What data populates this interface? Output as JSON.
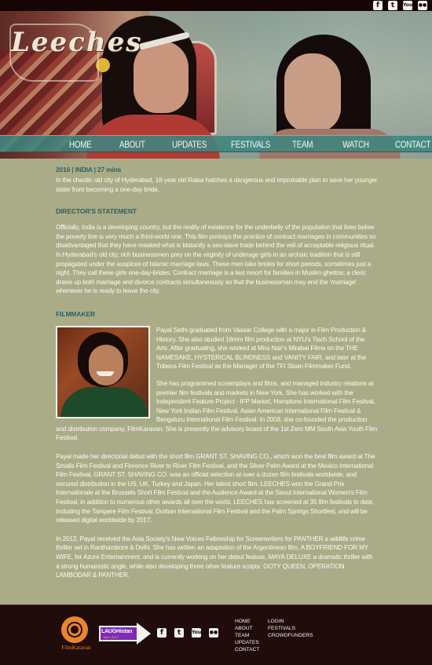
{
  "social": {
    "facebook_glyph": "f",
    "twitter_glyph": "t",
    "youtube_glyph": "You",
    "flickr_glyph": "●●"
  },
  "logo_text": "Leeches",
  "nav": [
    "Home",
    "About",
    "Updates",
    "Festivals",
    "Team",
    "Watch",
    "Contact"
  ],
  "meta": "2016 | INDIA | 27 mins",
  "synopsis": "In the chaotic old city of Hyderabad, 18-year old Raisa hatches a dangerous and improbable plan to save her younger sister from becoming a one-day bride.",
  "directors_statement": {
    "heading": "Director's Statement",
    "text": "Officially, India is a developing country, but the reality of existence for the underbelly of the population that lives below the poverty line is very much a third-world one. This film portrays the practice of contract marriages in communities so disadvantaged that they have masked what is blatantly a sex-slave trade behind the veil of acceptable religious ritual. In Hyderabad's old city, rich businessmen prey on the virginity of underage girls in an archaic tradition that is still propagated under the auspices of Islamic marriage laws. These men take brides for short periods, sometimes just a night. They call these girls one-day-brides. Contract marriage is a last resort for families in Muslim ghettos; a cleric draws up both marriage and divorce contracts simultaneously so that the businessman may end the 'marriage' whenever he is ready to leave the city."
  },
  "filmmaker": {
    "heading": "Filmmaker",
    "para1": "Payal Sethi graduated from Vassar College with a major in Film Production & History. She also studied 16mm film production at NYU's Tisch School of the Arts. After graduating, she worked at Mira Nair's Mirabai Films on the THE NAMESAKE, HYSTERICAL BLINDNESS and VANITY FAIR, and later at the Tribeca Film Festival as the Manager of the TFI Sloan Filmmaker Fund.",
    "para2": "She has programmed screenplays and films, and managed industry relations at premier film festivals and markets in New York. She has worked with the Independent Feature Project - IFP Market, Hamptons International Film Festival, New York Indian Film Festival, Asian American International Film Festival & Bengaluru International Film Festival. In 2008, she co-founded the production and distribution company, FilmKaravan. She is presently the advisory board of the 1st Zero MM South Asia Youth Film Festival.",
    "para3": "Payal made her directorial debut with the short film GRANT ST. SHAVING CO., which won the best film award at The Smalls Film Festival and Florence River to River Film Festival, and the Silver Palm Award at the Mexico International Film Festival. GRANT ST. SHAVING CO. was an official selection at over a dozen film festivals worldwide, and secured distribution in the US, UK, Turkey and Japan. Her latest short film, LEECHES won the Grand Prix Internationale at the Brussels Short Film Festival and the Audience Award at the Seoul International Women's Film Festival, in addition to numerous other awards all over the world. LEECHES has screened at 35 film festivals to date, including the Tampere Film Festival, Durban International Film Festival and the Palm Springs Shortfest, and will be released digital worldwide by 2017.",
    "para4": "In 2012, Payal received the Asia Society's New Voices Fellowship for Screenwriters for PANTHER a wildlife crime thriller set in Ranthambore & Delhi. She has written an adaptation of the Argentinean film, A BOYFRIEND FOR MY WIFE, for Azure Entertainment, and is currently working on her debut feature, MAYA DELUXE a dramatic thriller with a strong humanistic angle, while also developing three other feature scripts: OOTY QUEEN, OPERATION LAMBODAR & PANTHER."
  },
  "footer": {
    "filmkaravan": "FilmKaravan",
    "laughistan": "LAUGHistan",
    "laughistan_sub": "fest • 2017",
    "nav_col1": [
      "Home",
      "About",
      "Team",
      "Updates",
      "Contact"
    ],
    "nav_col2": [
      "Login",
      "Festivals",
      "Crowdfunders"
    ]
  },
  "colors": {
    "content_bg": "#a9ac86",
    "heading": "#335f61",
    "nav_bg": "#3d857e",
    "footer_bg": "#1f0c0b",
    "brand_orange": "#e7862b"
  }
}
